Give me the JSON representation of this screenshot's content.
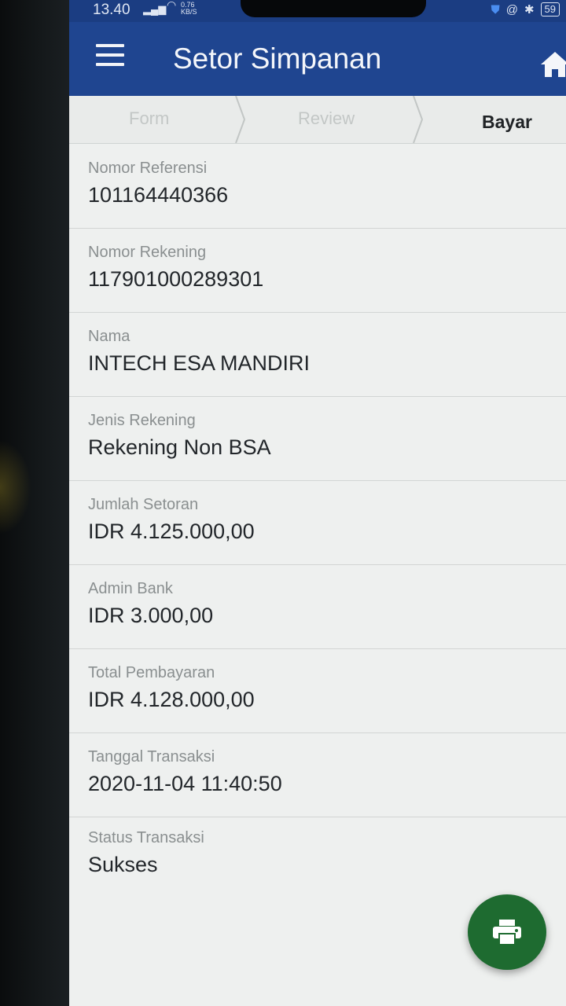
{
  "status_bar": {
    "time": "13.40",
    "speed": "0.76\nKB/S",
    "battery": "59"
  },
  "app_bar": {
    "title": "Setor Simpanan",
    "menu_icon": "hamburger-menu-icon",
    "home_icon": "home-icon"
  },
  "steps": [
    {
      "label": "Form",
      "state": "done"
    },
    {
      "label": "Review",
      "state": "done"
    },
    {
      "label": "Bayar",
      "state": "active"
    }
  ],
  "fields": [
    {
      "label": "Nomor Referensi",
      "value": "101164440366"
    },
    {
      "label": "Nomor Rekening",
      "value": "117901000289301"
    },
    {
      "label": "Nama",
      "value": "INTECH ESA MANDIRI"
    },
    {
      "label": "Jenis Rekening",
      "value": "Rekening Non BSA"
    },
    {
      "label": "Jumlah Setoran",
      "value": "IDR 4.125.000,00"
    },
    {
      "label": "Admin Bank",
      "value": "IDR 3.000,00"
    },
    {
      "label": "Total Pembayaran",
      "value": "IDR 4.128.000,00"
    },
    {
      "label": "Tanggal Transaksi",
      "value": "2020-11-04 11:40:50"
    },
    {
      "label": "Status Transaksi",
      "value": "Sukses"
    }
  ],
  "fab": {
    "icon": "print-icon"
  },
  "colors": {
    "app_bar": "#1f4590",
    "fab": "#1e6b30",
    "background": "#eef0ef"
  }
}
